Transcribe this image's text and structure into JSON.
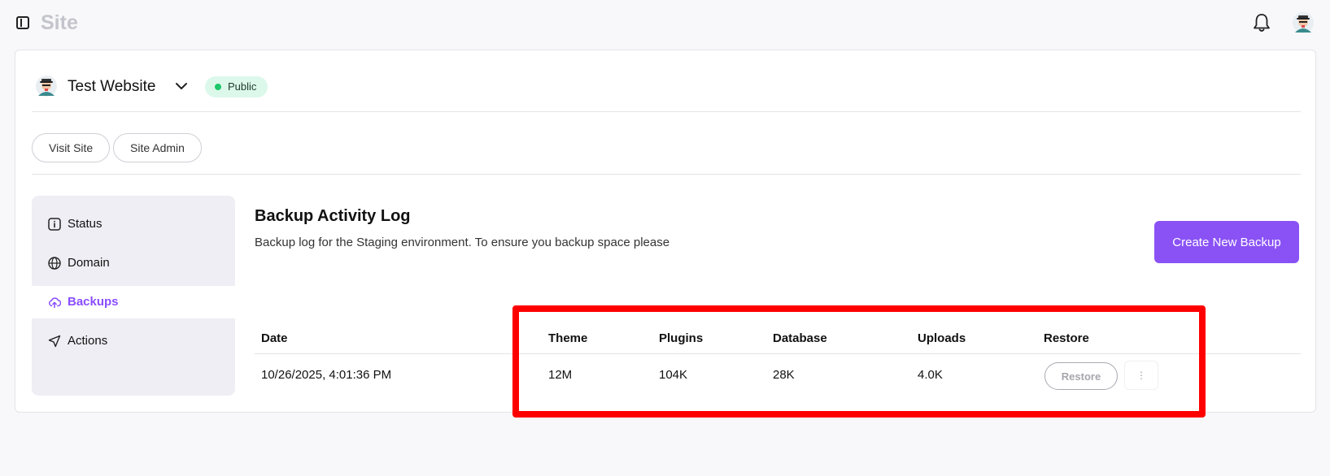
{
  "topbar": {
    "title": "Site"
  },
  "site": {
    "name": "Test Website",
    "visibility": "Public"
  },
  "actions": {
    "visit_site": "Visit Site",
    "site_admin": "Site Admin"
  },
  "nav": {
    "items": [
      {
        "label": "Status",
        "icon": "info-icon"
      },
      {
        "label": "Domain",
        "icon": "globe-icon"
      },
      {
        "label": "Backups",
        "icon": "cloud-upload-icon",
        "active": true
      },
      {
        "label": "Actions",
        "icon": "send-icon"
      }
    ]
  },
  "backup": {
    "title": "Backup Activity Log",
    "description": "Backup log for the Staging environment. To ensure you backup space please",
    "create_label": "Create New Backup",
    "columns": [
      "Date",
      "Theme",
      "Plugins",
      "Database",
      "Uploads",
      "Restore"
    ],
    "rows": [
      {
        "date": "10/26/2025, 4:01:36 PM",
        "theme": "12M",
        "plugins": "104K",
        "database": "28K",
        "uploads": "4.0K",
        "restore_label": "Restore",
        "more_label": "⋮"
      }
    ]
  },
  "colors": {
    "accent": "#8a52f5",
    "public_badge_bg": "#dcf8ea",
    "public_dot": "#1ec76a",
    "highlight": "#ff0000"
  }
}
